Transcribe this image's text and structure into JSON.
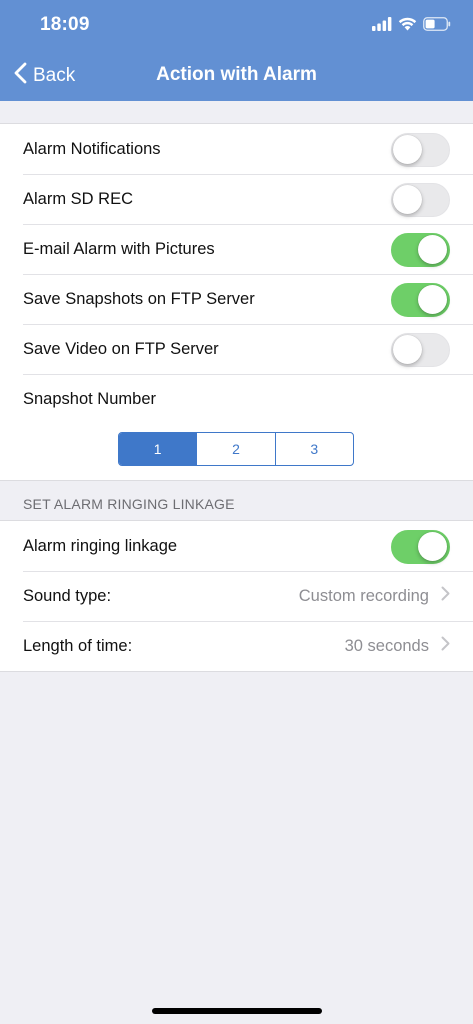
{
  "status_bar": {
    "time": "18:09",
    "icons": [
      "signal-icon",
      "wifi-icon",
      "battery-icon"
    ]
  },
  "nav": {
    "back_label": "Back",
    "title": "Action with Alarm"
  },
  "colors": {
    "header": "#6290d3",
    "toggle_on": "#6ecf68",
    "segment_accent": "#3f78c9"
  },
  "alarm_settings": {
    "items": [
      {
        "label": "Alarm Notifications",
        "on": false
      },
      {
        "label": "Alarm SD REC",
        "on": false
      },
      {
        "label": "E-mail Alarm with Pictures",
        "on": true
      },
      {
        "label": "Save Snapshots on FTP Server",
        "on": true
      },
      {
        "label": "Save Video on FTP Server",
        "on": false
      }
    ],
    "snapshot_number_label": "Snapshot Number",
    "snapshot_options": [
      "1",
      "2",
      "3"
    ],
    "snapshot_selected": "1"
  },
  "ringing": {
    "section_header": "SET ALARM RINGING LINKAGE",
    "linkage_label": "Alarm ringing linkage",
    "linkage_on": true,
    "sound_type_label": "Sound type:",
    "sound_type_value": "Custom recording",
    "length_label": "Length of time:",
    "length_value": "30 seconds"
  }
}
